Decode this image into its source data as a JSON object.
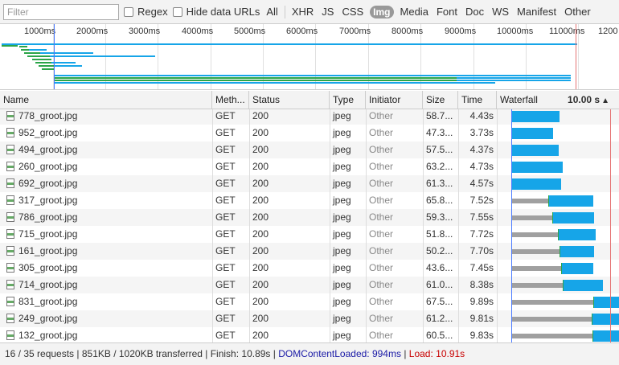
{
  "filterbar": {
    "filter_placeholder": "Filter",
    "regex_label": "Regex",
    "hide_data_urls_label": "Hide data URLs",
    "types": [
      "All",
      "XHR",
      "JS",
      "CSS",
      "Img",
      "Media",
      "Font",
      "Doc",
      "WS",
      "Manifest",
      "Other"
    ],
    "active_type": "Img"
  },
  "overview": {
    "tick_labels": [
      "1000ms",
      "2000ms",
      "3000ms",
      "4000ms",
      "5000ms",
      "6000ms",
      "7000ms",
      "8000ms",
      "9000ms",
      "10000ms",
      "11000ms",
      "1200"
    ]
  },
  "columns": {
    "name": "Name",
    "method": "Meth...",
    "status": "Status",
    "type": "Type",
    "initiator": "Initiator",
    "size": "Size",
    "time": "Time",
    "waterfall": "Waterfall",
    "waterfall_time": "10.00 s"
  },
  "rows": [
    {
      "name": "778_groot.jpg",
      "method": "GET",
      "status": "200",
      "type": "jpeg",
      "initiator": "Other",
      "size": "58.7...",
      "time": "4.43s"
    },
    {
      "name": "952_groot.jpg",
      "method": "GET",
      "status": "200",
      "type": "jpeg",
      "initiator": "Other",
      "size": "47.3...",
      "time": "3.73s"
    },
    {
      "name": "494_groot.jpg",
      "method": "GET",
      "status": "200",
      "type": "jpeg",
      "initiator": "Other",
      "size": "57.5...",
      "time": "4.37s"
    },
    {
      "name": "260_groot.jpg",
      "method": "GET",
      "status": "200",
      "type": "jpeg",
      "initiator": "Other",
      "size": "63.2...",
      "time": "4.73s"
    },
    {
      "name": "692_groot.jpg",
      "method": "GET",
      "status": "200",
      "type": "jpeg",
      "initiator": "Other",
      "size": "61.3...",
      "time": "4.57s"
    },
    {
      "name": "317_groot.jpg",
      "method": "GET",
      "status": "200",
      "type": "jpeg",
      "initiator": "Other",
      "size": "65.8...",
      "time": "7.52s"
    },
    {
      "name": "786_groot.jpg",
      "method": "GET",
      "status": "200",
      "type": "jpeg",
      "initiator": "Other",
      "size": "59.3...",
      "time": "7.55s"
    },
    {
      "name": "715_groot.jpg",
      "method": "GET",
      "status": "200",
      "type": "jpeg",
      "initiator": "Other",
      "size": "51.8...",
      "time": "7.72s"
    },
    {
      "name": "161_groot.jpg",
      "method": "GET",
      "status": "200",
      "type": "jpeg",
      "initiator": "Other",
      "size": "50.2...",
      "time": "7.70s"
    },
    {
      "name": "305_groot.jpg",
      "method": "GET",
      "status": "200",
      "type": "jpeg",
      "initiator": "Other",
      "size": "43.6...",
      "time": "7.45s"
    },
    {
      "name": "714_groot.jpg",
      "method": "GET",
      "status": "200",
      "type": "jpeg",
      "initiator": "Other",
      "size": "61.0...",
      "time": "8.38s"
    },
    {
      "name": "831_groot.jpg",
      "method": "GET",
      "status": "200",
      "type": "jpeg",
      "initiator": "Other",
      "size": "67.5...",
      "time": "9.89s"
    },
    {
      "name": "249_groot.jpg",
      "method": "GET",
      "status": "200",
      "type": "jpeg",
      "initiator": "Other",
      "size": "61.2...",
      "time": "9.81s"
    },
    {
      "name": "132_groot.jpg",
      "method": "GET",
      "status": "200",
      "type": "jpeg",
      "initiator": "Other",
      "size": "60.5...",
      "time": "9.83s"
    }
  ],
  "statusbar": {
    "summary": "16 / 35 requests | 851KB / 1020KB transferred | Finish: 10.89s | ",
    "dcl": "DOMContentLoaded: 994ms",
    "sep": " | ",
    "load": "Load: 10.91s"
  },
  "colors": {
    "receiving": "#16a5e8",
    "waiting": "#a0a0a0",
    "sending": "#2ba549",
    "dcl_line": "#4b7bff",
    "load_line": "#e57373"
  }
}
